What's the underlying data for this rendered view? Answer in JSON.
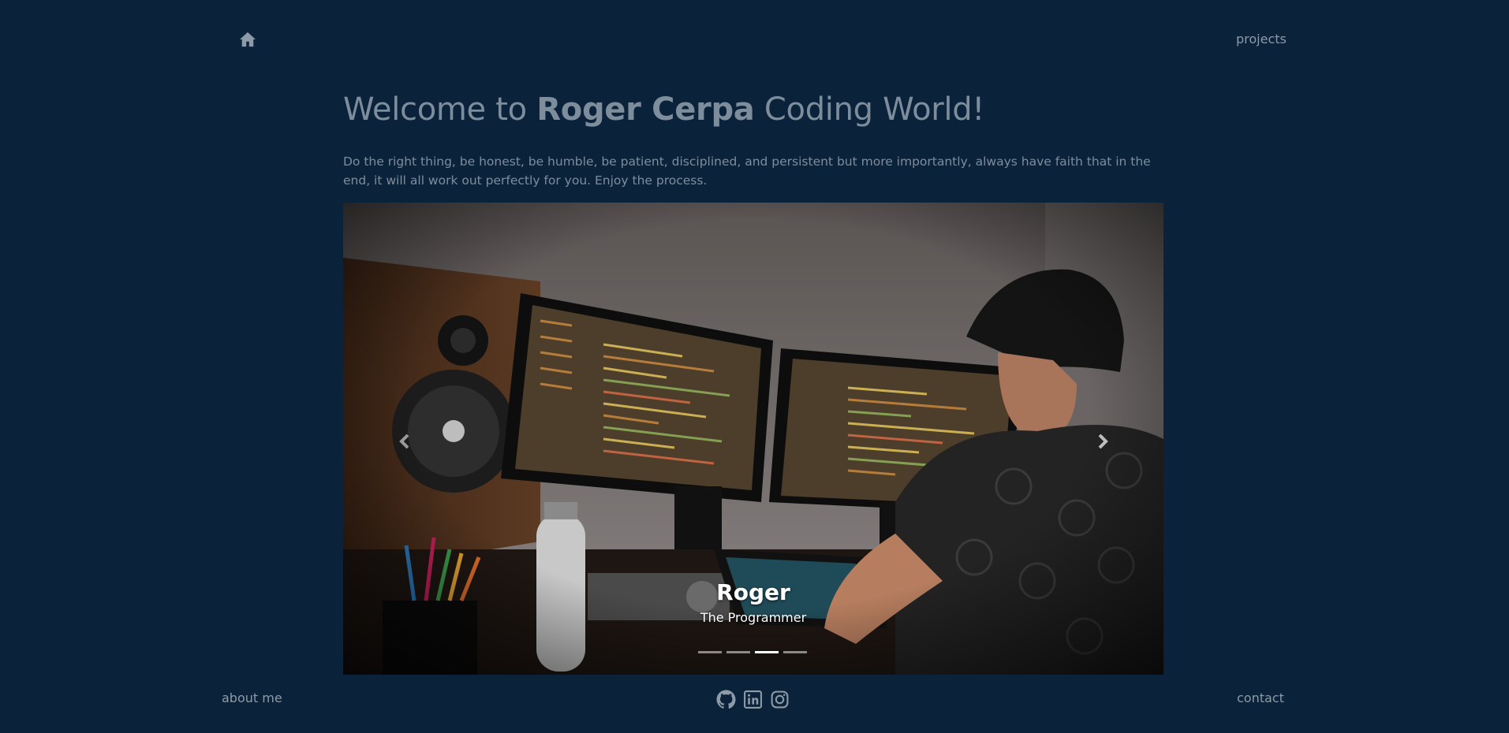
{
  "nav": {
    "home_icon": "home-icon",
    "projects_label": "projects"
  },
  "hero": {
    "title_prefix": "Welcome to ",
    "title_name": "Roger Cerpa",
    "title_suffix": " Coding World!",
    "motto": "Do the right thing, be honest, be humble, be patient, disciplined, and persistent but more importantly, always have faith that in the end, it will all work out perfectly for you. Enjoy the process."
  },
  "carousel": {
    "caption_title": "Roger",
    "caption_subtitle": "The Programmer",
    "slide_count": 4,
    "active_index": 2,
    "prev_icon": "chevron-left-icon",
    "next_icon": "chevron-right-icon"
  },
  "footer": {
    "about_label": "about me",
    "contact_label": "contact",
    "social": [
      {
        "name": "github",
        "icon": "github-icon"
      },
      {
        "name": "linkedin",
        "icon": "linkedin-icon"
      },
      {
        "name": "instagram",
        "icon": "instagram-icon"
      }
    ]
  },
  "colors": {
    "background": "#0b233a",
    "text_muted": "#7d8d9c",
    "link": "#8d9aa7",
    "caption": "#ffffff"
  }
}
